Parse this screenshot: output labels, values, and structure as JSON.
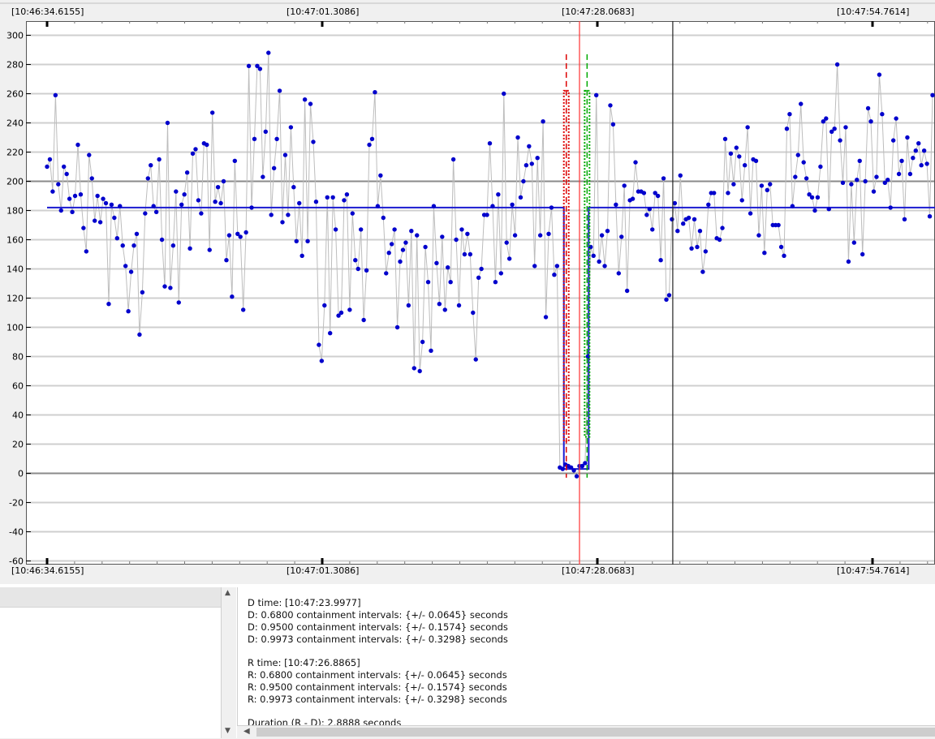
{
  "top_timestamps": [
    "[10:46:34.6155]",
    "[10:47:01.3086]",
    "[10:47:28.0683]",
    "[10:47:54.7614]"
  ],
  "bottom_timestamps": [
    "[10:46:34.6155]",
    "[10:47:01.3086]",
    "[10:47:28.0683]",
    "[10:47:54.7614]"
  ],
  "info": {
    "d_time": "D time: [10:47:23.9977]",
    "d_ci1": "D: 0.6800 containment intervals: {+/- 0.0645} seconds",
    "d_ci2": "D: 0.9500 containment intervals: {+/- 0.1574} seconds",
    "d_ci3": "D: 0.9973 containment intervals: {+/- 0.3298} seconds",
    "r_time": "R time: [10:47:26.8865]",
    "r_ci1": "R: 0.6800 containment intervals: {+/- 0.0645} seconds",
    "r_ci2": "R: 0.9500 containment intervals: {+/- 0.1574} seconds",
    "r_ci3": "R: 0.9973 containment intervals: {+/- 0.3298} seconds",
    "duration": "Duration (R - D): 2.8888 seconds"
  },
  "icons": {
    "scroll_up": "scroll-up-arrow",
    "scroll_down": "scroll-down-arrow",
    "scroll_left": "scroll-left-arrow"
  },
  "colors": {
    "series": "#0000cc",
    "series_line": "#bdbdbd",
    "step": "#1a1ad0",
    "d_marker": "#dd0000",
    "r_marker": "#00aa00",
    "cursor": "#ff3333"
  },
  "chart_data": {
    "type": "scatter",
    "ylim": [
      -60,
      300
    ],
    "yticks": [
      -60,
      -40,
      -20,
      0,
      20,
      40,
      60,
      80,
      100,
      120,
      140,
      160,
      180,
      200,
      220,
      240,
      260,
      280,
      300
    ],
    "xticks": [
      "[10:46:34.6155]",
      "[10:47:01.3086]",
      "[10:47:28.0683]",
      "[10:47:54.7614]"
    ],
    "x_units": "sample index",
    "xlim": [
      0,
      291
    ],
    "y": [
      210,
      215,
      193,
      259,
      198,
      180,
      210,
      205,
      188,
      179,
      190,
      225,
      191,
      168,
      152,
      218,
      202,
      173,
      190,
      172,
      188,
      185,
      116,
      184,
      175,
      161,
      183,
      156,
      142,
      111,
      138,
      156,
      164,
      95,
      124,
      178,
      202,
      211,
      183,
      179,
      215,
      160,
      128,
      240,
      127,
      156,
      193,
      117,
      184,
      191,
      206,
      154,
      219,
      222,
      187,
      178,
      226,
      225,
      153,
      247,
      186,
      196,
      185,
      200,
      146,
      163,
      121,
      214,
      164,
      162,
      112,
      165,
      279,
      182,
      229,
      279,
      277,
      203,
      234,
      288,
      177,
      209,
      229,
      262,
      172,
      218,
      177,
      237,
      196,
      159,
      185,
      149,
      256,
      159,
      253,
      227,
      186,
      88,
      77,
      115,
      189,
      96,
      189,
      167,
      108,
      110,
      187,
      191,
      112,
      178,
      146,
      140,
      167,
      105,
      139,
      225,
      229,
      261,
      183,
      204,
      175,
      137,
      151,
      157,
      167,
      100,
      145,
      153,
      158,
      115,
      166,
      72,
      163,
      70,
      90,
      155,
      131,
      84,
      183,
      144,
      116,
      162,
      112,
      141,
      131,
      215,
      160,
      115,
      167,
      150,
      164,
      150,
      110,
      78,
      134,
      140,
      177,
      177,
      226,
      183,
      131,
      191,
      137,
      260,
      158,
      147,
      184,
      163,
      230,
      189,
      200,
      211,
      224,
      212,
      142,
      216,
      163,
      241,
      107,
      164,
      182,
      136,
      142,
      4,
      3,
      6,
      5,
      4,
      2,
      -2,
      5,
      5,
      7,
      80,
      155,
      149,
      259,
      145,
      163,
      142,
      166,
      252,
      239,
      184,
      137,
      162,
      197,
      125,
      187,
      188,
      213,
      193,
      193,
      192,
      177,
      181,
      167,
      192,
      190,
      146,
      202,
      119,
      122,
      174,
      185,
      166,
      204,
      171,
      174,
      175,
      154,
      174,
      155,
      166,
      138,
      152,
      184,
      192,
      192,
      161,
      160,
      168,
      229,
      192,
      219,
      198,
      223,
      217,
      187,
      211,
      237,
      178,
      215,
      214,
      163,
      197,
      151,
      194,
      198,
      170,
      170,
      170,
      155,
      149,
      236,
      246,
      183,
      203,
      218,
      253,
      213,
      202,
      191,
      189,
      180,
      189,
      210,
      241,
      243,
      181,
      234,
      236,
      280,
      228,
      199,
      237,
      145,
      198,
      158,
      201,
      214,
      150,
      200,
      250,
      241,
      193,
      203,
      273,
      246,
      199,
      201,
      182,
      228,
      243,
      205,
      214,
      174,
      230,
      205,
      216,
      221,
      226,
      211,
      221,
      212,
      176,
      259
    ],
    "fit_levels": {
      "baseline": 182,
      "dip": 3
    },
    "d_index": 185,
    "r_index": 193,
    "cursor_index": 190,
    "black_cursor_index": 223,
    "markers": [
      "D",
      "R"
    ]
  }
}
